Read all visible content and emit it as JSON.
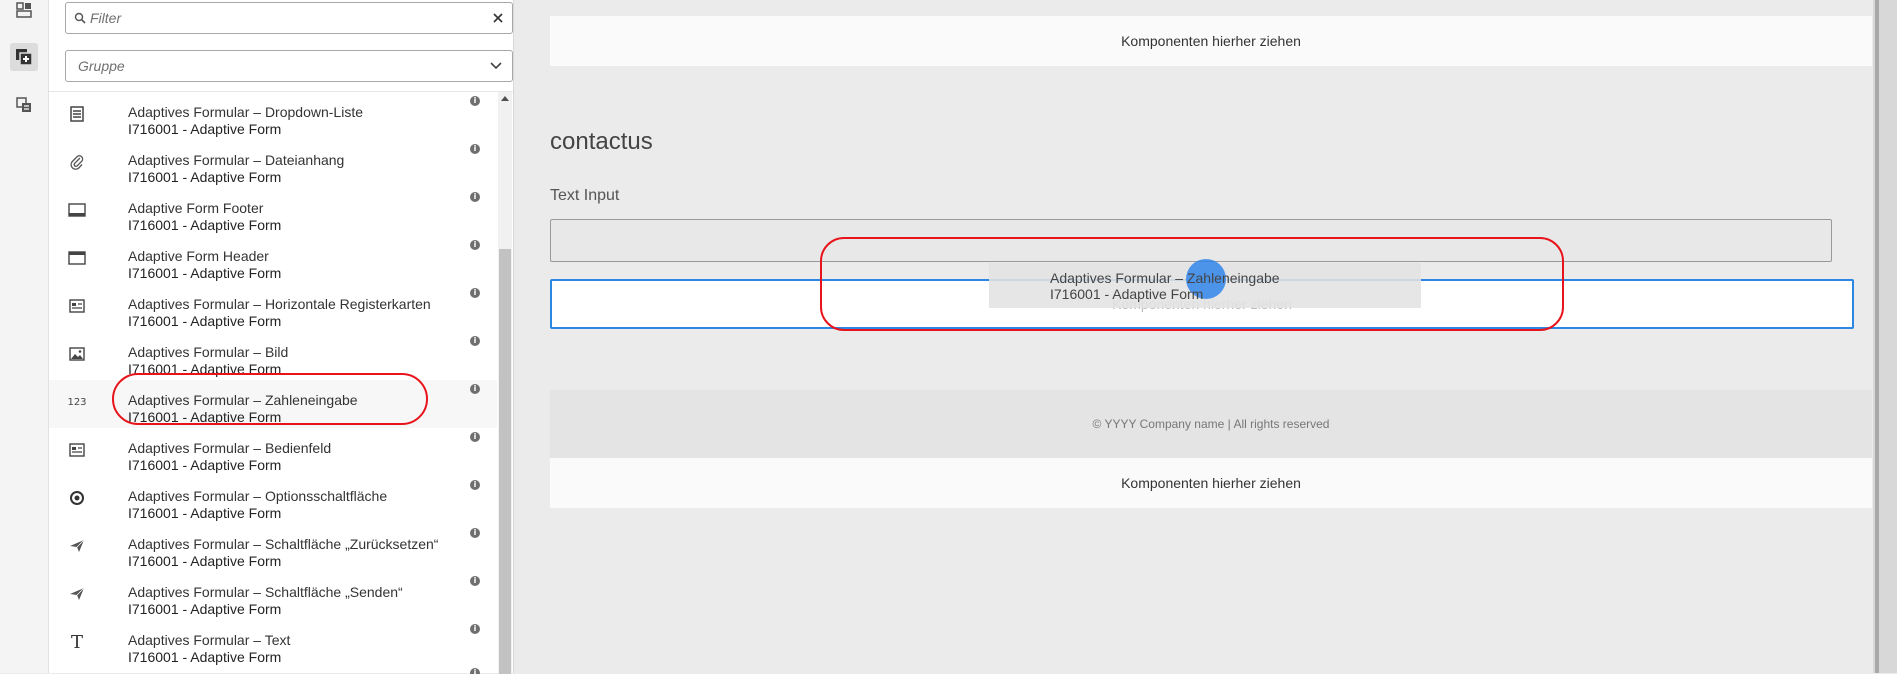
{
  "rail": {
    "buttons": [
      {
        "name": "assets-icon",
        "active": false
      },
      {
        "name": "components-icon",
        "active": true
      },
      {
        "name": "content-tree-icon",
        "active": false
      }
    ]
  },
  "panel": {
    "filter": {
      "placeholder": "Filter",
      "value": ""
    },
    "group": {
      "placeholder": "Gruppe"
    },
    "items": [
      {
        "title": "Adaptives Formular – Dropdown-Liste",
        "subtitle": "I716001 - Adaptive Form",
        "icon": "dropdown-list-icon"
      },
      {
        "title": "Adaptives Formular – Dateianhang",
        "subtitle": "I716001 - Adaptive Form",
        "icon": "attachment-icon"
      },
      {
        "title": "Adaptive Form Footer",
        "subtitle": "I716001 - Adaptive Form",
        "icon": "footer-icon"
      },
      {
        "title": "Adaptive Form Header",
        "subtitle": "I716001 - Adaptive Form",
        "icon": "header-icon"
      },
      {
        "title": "Adaptives Formular – Horizontale Registerkarten",
        "subtitle": "I716001 - Adaptive Form",
        "icon": "tabs-icon"
      },
      {
        "title": "Adaptives Formular – Bild",
        "subtitle": "I716001 - Adaptive Form",
        "icon": "image-icon"
      },
      {
        "title": "Adaptives Formular – Zahleneingabe",
        "subtitle": "I716001 - Adaptive Form",
        "icon": "number-input-icon",
        "icon_text": "123"
      },
      {
        "title": "Adaptives Formular – Bedienfeld",
        "subtitle": "I716001 - Adaptive Form",
        "icon": "panel-icon"
      },
      {
        "title": "Adaptives Formular – Optionsschaltfläche",
        "subtitle": "I716001 - Adaptive Form",
        "icon": "radio-button-icon"
      },
      {
        "title": "Adaptives Formular – Schaltfläche „Zurücksetzen“",
        "subtitle": "I716001 - Adaptive Form",
        "icon": "send-icon"
      },
      {
        "title": "Adaptives Formular – Schaltfläche „Senden“",
        "subtitle": "I716001 - Adaptive Form",
        "icon": "send-icon"
      },
      {
        "title": "Adaptives Formular – Text",
        "subtitle": "I716001 - Adaptive Form",
        "icon": "text-icon",
        "icon_text": "T"
      }
    ],
    "info_glyph": "i"
  },
  "canvas": {
    "drop_zone_label": "Komponenten hierher ziehen",
    "form_title": "contactus",
    "field_label": "Text Input",
    "footer_text": "© YYYY Company name | All rights reserved",
    "accent_color": "#2d86e1"
  },
  "drag_ghost": {
    "title": "Adaptives Formular – Zahleneingabe",
    "subtitle": "I716001 - Adaptive Form"
  },
  "annotation_color": "#e8141b"
}
